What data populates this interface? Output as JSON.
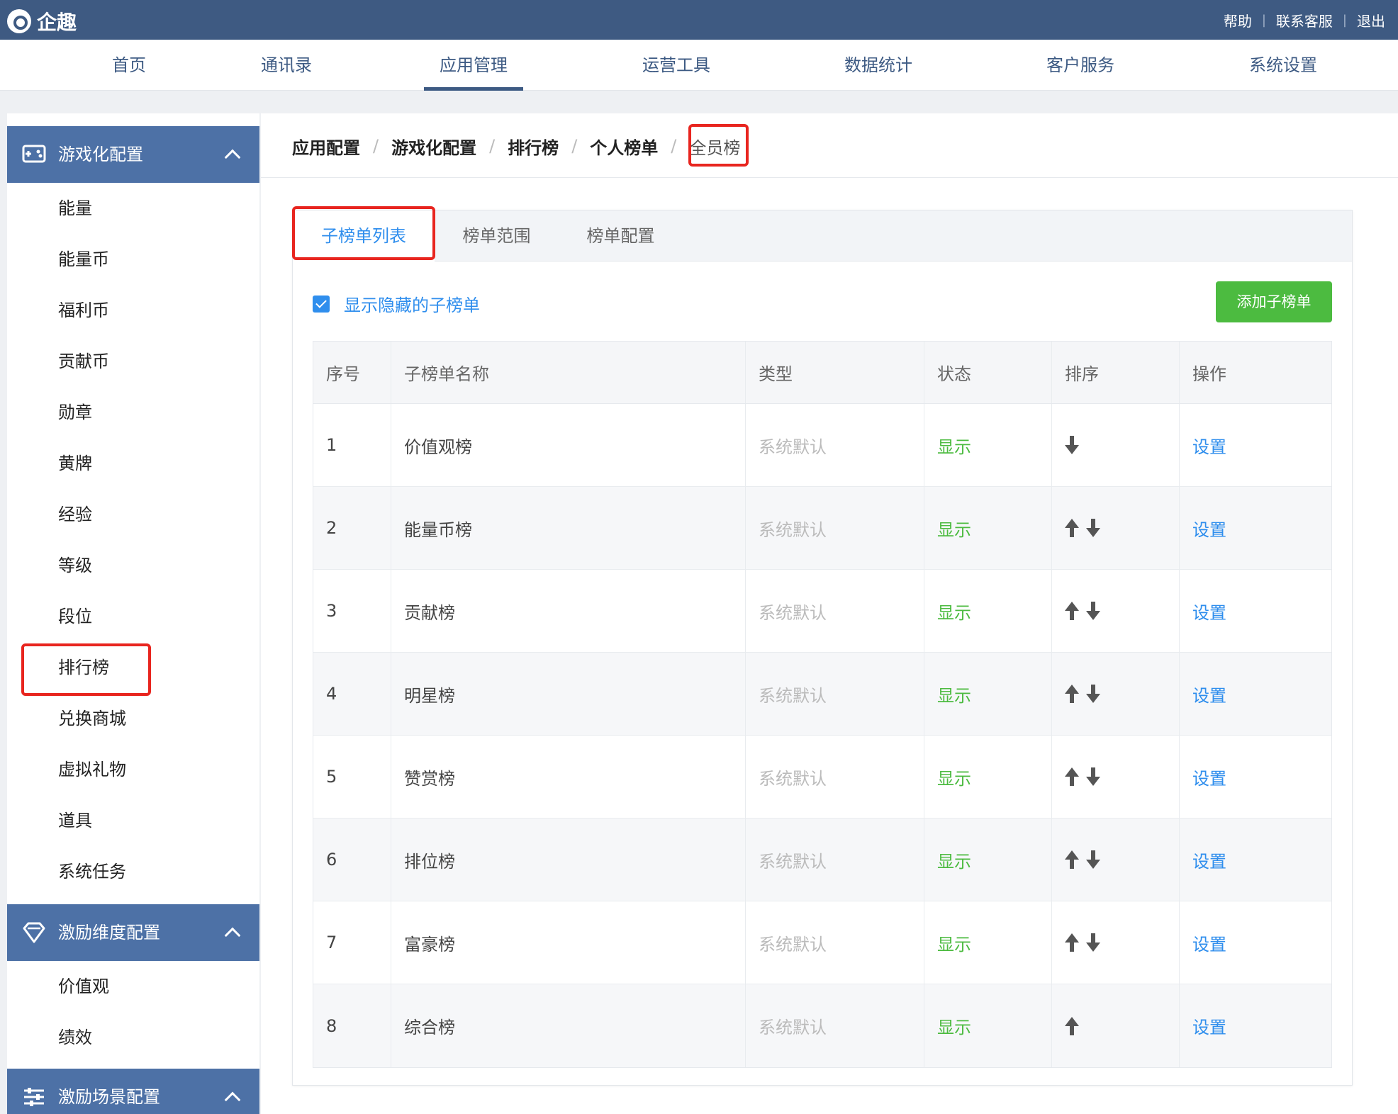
{
  "header": {
    "logo_text": "企趣",
    "links": [
      "帮助",
      "联系客服",
      "退出"
    ]
  },
  "nav": {
    "items": [
      "首页",
      "通讯录",
      "应用管理",
      "运营工具",
      "数据统计",
      "客户服务",
      "系统设置"
    ],
    "active": "应用管理"
  },
  "sidebar": {
    "group1": {
      "label": "游戏化配置",
      "icon": "game-icon"
    },
    "group1_items": [
      "能量",
      "能量币",
      "福利币",
      "贡献币",
      "勋章",
      "黄牌",
      "经验",
      "等级",
      "段位",
      "排行榜",
      "兑换商城",
      "虚拟礼物",
      "道具",
      "系统任务"
    ],
    "group2": {
      "label": "激励维度配置",
      "icon": "diamond-icon"
    },
    "group2_items": [
      "价值观",
      "绩效"
    ],
    "group3": {
      "label": "激励场景配置",
      "icon": "sliders-icon"
    },
    "selected": "排行榜"
  },
  "breadcrumb": [
    "应用配置",
    "游戏化配置",
    "排行榜",
    "个人榜单",
    "全员榜"
  ],
  "tabs": [
    "子榜单列表",
    "榜单范围",
    "榜单配置"
  ],
  "active_tab": "子榜单列表",
  "show_hidden": {
    "label": "显示隐藏的子榜单",
    "checked": true
  },
  "add_button": "添加子榜单",
  "table": {
    "headers": [
      "序号",
      "子榜单名称",
      "类型",
      "状态",
      "排序",
      "操作"
    ],
    "rows": [
      {
        "idx": "1",
        "name": "价值观榜",
        "type": "系统默认",
        "status": "显示",
        "sort": [
          "down"
        ],
        "op": "设置"
      },
      {
        "idx": "2",
        "name": "能量币榜",
        "type": "系统默认",
        "status": "显示",
        "sort": [
          "up",
          "down"
        ],
        "op": "设置"
      },
      {
        "idx": "3",
        "name": "贡献榜",
        "type": "系统默认",
        "status": "显示",
        "sort": [
          "up",
          "down"
        ],
        "op": "设置"
      },
      {
        "idx": "4",
        "name": "明星榜",
        "type": "系统默认",
        "status": "显示",
        "sort": [
          "up",
          "down"
        ],
        "op": "设置"
      },
      {
        "idx": "5",
        "name": "赞赏榜",
        "type": "系统默认",
        "status": "显示",
        "sort": [
          "up",
          "down"
        ],
        "op": "设置"
      },
      {
        "idx": "6",
        "name": "排位榜",
        "type": "系统默认",
        "status": "显示",
        "sort": [
          "up",
          "down"
        ],
        "op": "设置"
      },
      {
        "idx": "7",
        "name": "富豪榜",
        "type": "系统默认",
        "status": "显示",
        "sort": [
          "up",
          "down"
        ],
        "op": "设置"
      },
      {
        "idx": "8",
        "name": "综合榜",
        "type": "系统默认",
        "status": "显示",
        "sort": [
          "up"
        ],
        "op": "设置"
      }
    ]
  },
  "colors": {
    "header_bg": "#3e5a82",
    "sidebar_group_bg": "#4d71a6",
    "accent_blue": "#2f8eed",
    "status_green": "#4cbb40",
    "highlight_red": "#e8251f"
  }
}
